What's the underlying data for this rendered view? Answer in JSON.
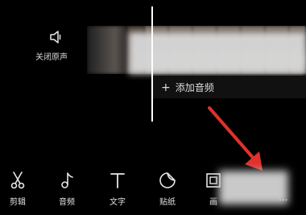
{
  "mute": {
    "icon": "speaker-mute-icon",
    "label": "关闭原声"
  },
  "audio": {
    "add_label": "添加音频",
    "plus": "+"
  },
  "toolbar": {
    "items": [
      {
        "icon": "scissors-icon",
        "label": "剪辑"
      },
      {
        "icon": "music-note-icon",
        "label": "音频"
      },
      {
        "icon": "text-T-icon",
        "label": "文字"
      },
      {
        "icon": "sticker-icon",
        "label": "贴纸"
      },
      {
        "icon": "frame-icon",
        "label": "画"
      }
    ],
    "more": "..."
  },
  "colors": {
    "background": "#000000",
    "arrow": "#e0312b",
    "playhead": "#ffffff"
  }
}
